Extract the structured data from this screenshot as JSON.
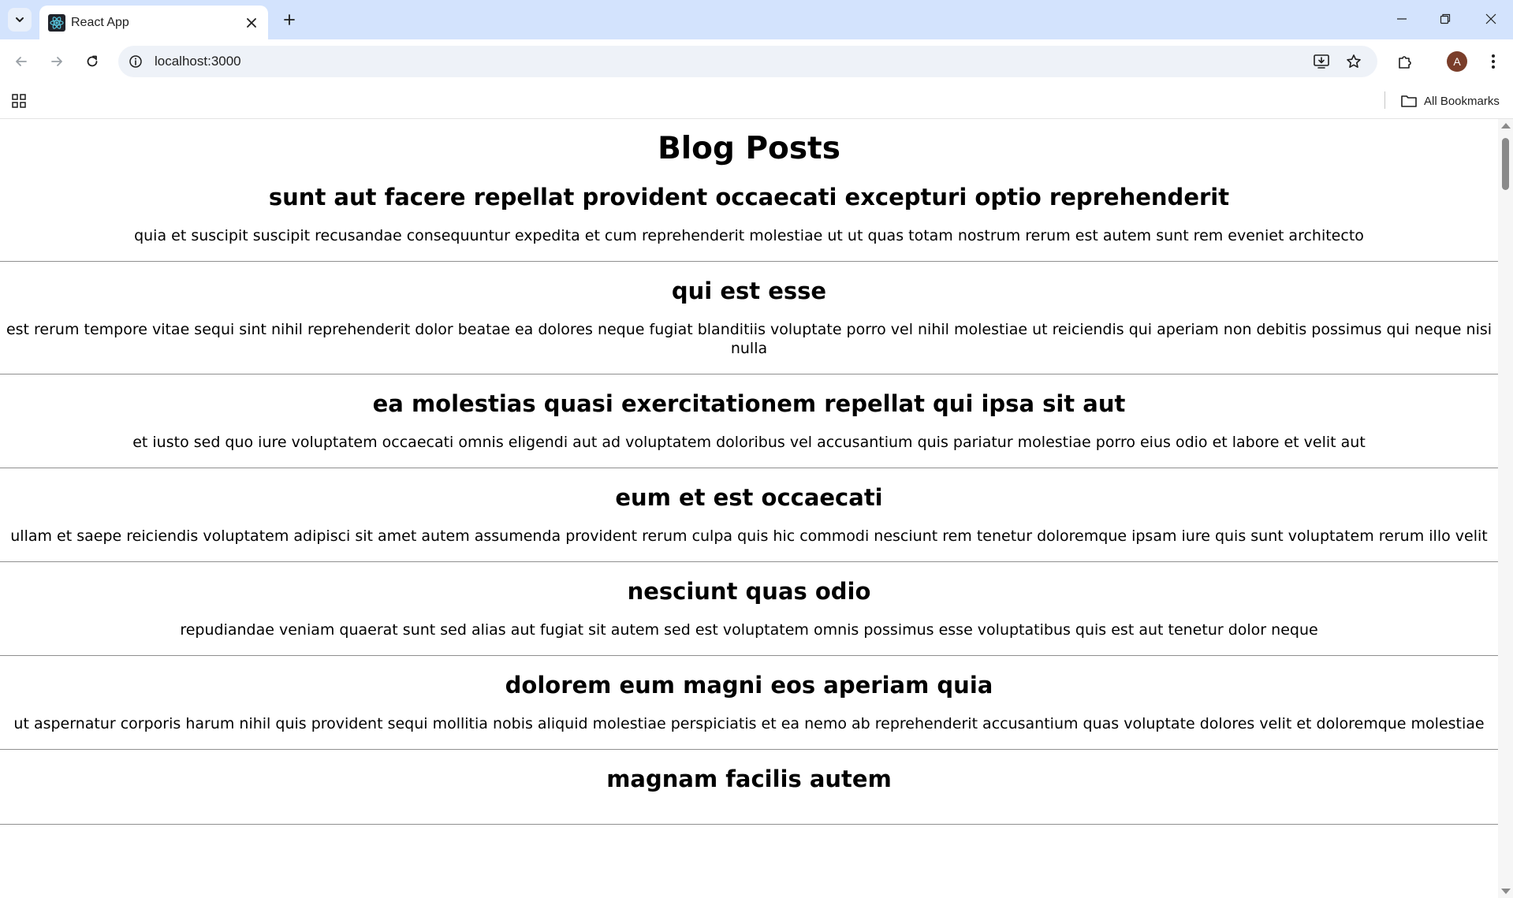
{
  "browser": {
    "tab_title": "React App",
    "url": "localhost:3000",
    "bookmarks_label": "All Bookmarks",
    "profile_initial": "A"
  },
  "page": {
    "heading": "Blog Posts",
    "posts": [
      {
        "title": "sunt aut facere repellat provident occaecati excepturi optio reprehenderit",
        "body": "quia et suscipit suscipit recusandae consequuntur expedita et cum reprehenderit molestiae ut ut quas totam nostrum rerum est autem sunt rem eveniet architecto"
      },
      {
        "title": "qui est esse",
        "body": "est rerum tempore vitae sequi sint nihil reprehenderit dolor beatae ea dolores neque fugiat blanditiis voluptate porro vel nihil molestiae ut reiciendis qui aperiam non debitis possimus qui neque nisi nulla"
      },
      {
        "title": "ea molestias quasi exercitationem repellat qui ipsa sit aut",
        "body": "et iusto sed quo iure voluptatem occaecati omnis eligendi aut ad voluptatem doloribus vel accusantium quis pariatur molestiae porro eius odio et labore et velit aut"
      },
      {
        "title": "eum et est occaecati",
        "body": "ullam et saepe reiciendis voluptatem adipisci sit amet autem assumenda provident rerum culpa quis hic commodi nesciunt rem tenetur doloremque ipsam iure quis sunt voluptatem rerum illo velit"
      },
      {
        "title": "nesciunt quas odio",
        "body": "repudiandae veniam quaerat sunt sed alias aut fugiat sit autem sed est voluptatem omnis possimus esse voluptatibus quis est aut tenetur dolor neque"
      },
      {
        "title": "dolorem eum magni eos aperiam quia",
        "body": "ut aspernatur corporis harum nihil quis provident sequi mollitia nobis aliquid molestiae perspiciatis et ea nemo ab reprehenderit accusantium quas voluptate dolores velit et doloremque molestiae"
      },
      {
        "title": "magnam facilis autem",
        "body": ""
      }
    ]
  },
  "icons": {
    "tab_search": "chevron-down-icon",
    "favicon": "react-logo-icon",
    "tab_close": "close-icon",
    "new_tab": "plus-icon",
    "minimize": "minimize-icon",
    "restore": "restore-icon",
    "close_window": "close-icon",
    "back": "back-arrow-icon",
    "forward": "forward-arrow-icon",
    "reload": "reload-icon",
    "site_info": "info-icon",
    "install": "install-app-icon",
    "bookmark_star": "star-icon",
    "extensions": "puzzle-icon",
    "menu": "kebab-menu-icon",
    "apps": "apps-grid-icon",
    "folder": "folder-icon"
  },
  "colors": {
    "tabbar_bg": "#d3e3fd",
    "omnibox_bg": "#eef2f8",
    "avatar_bg": "#7a3e2a",
    "react_blue": "#58c4dc"
  }
}
